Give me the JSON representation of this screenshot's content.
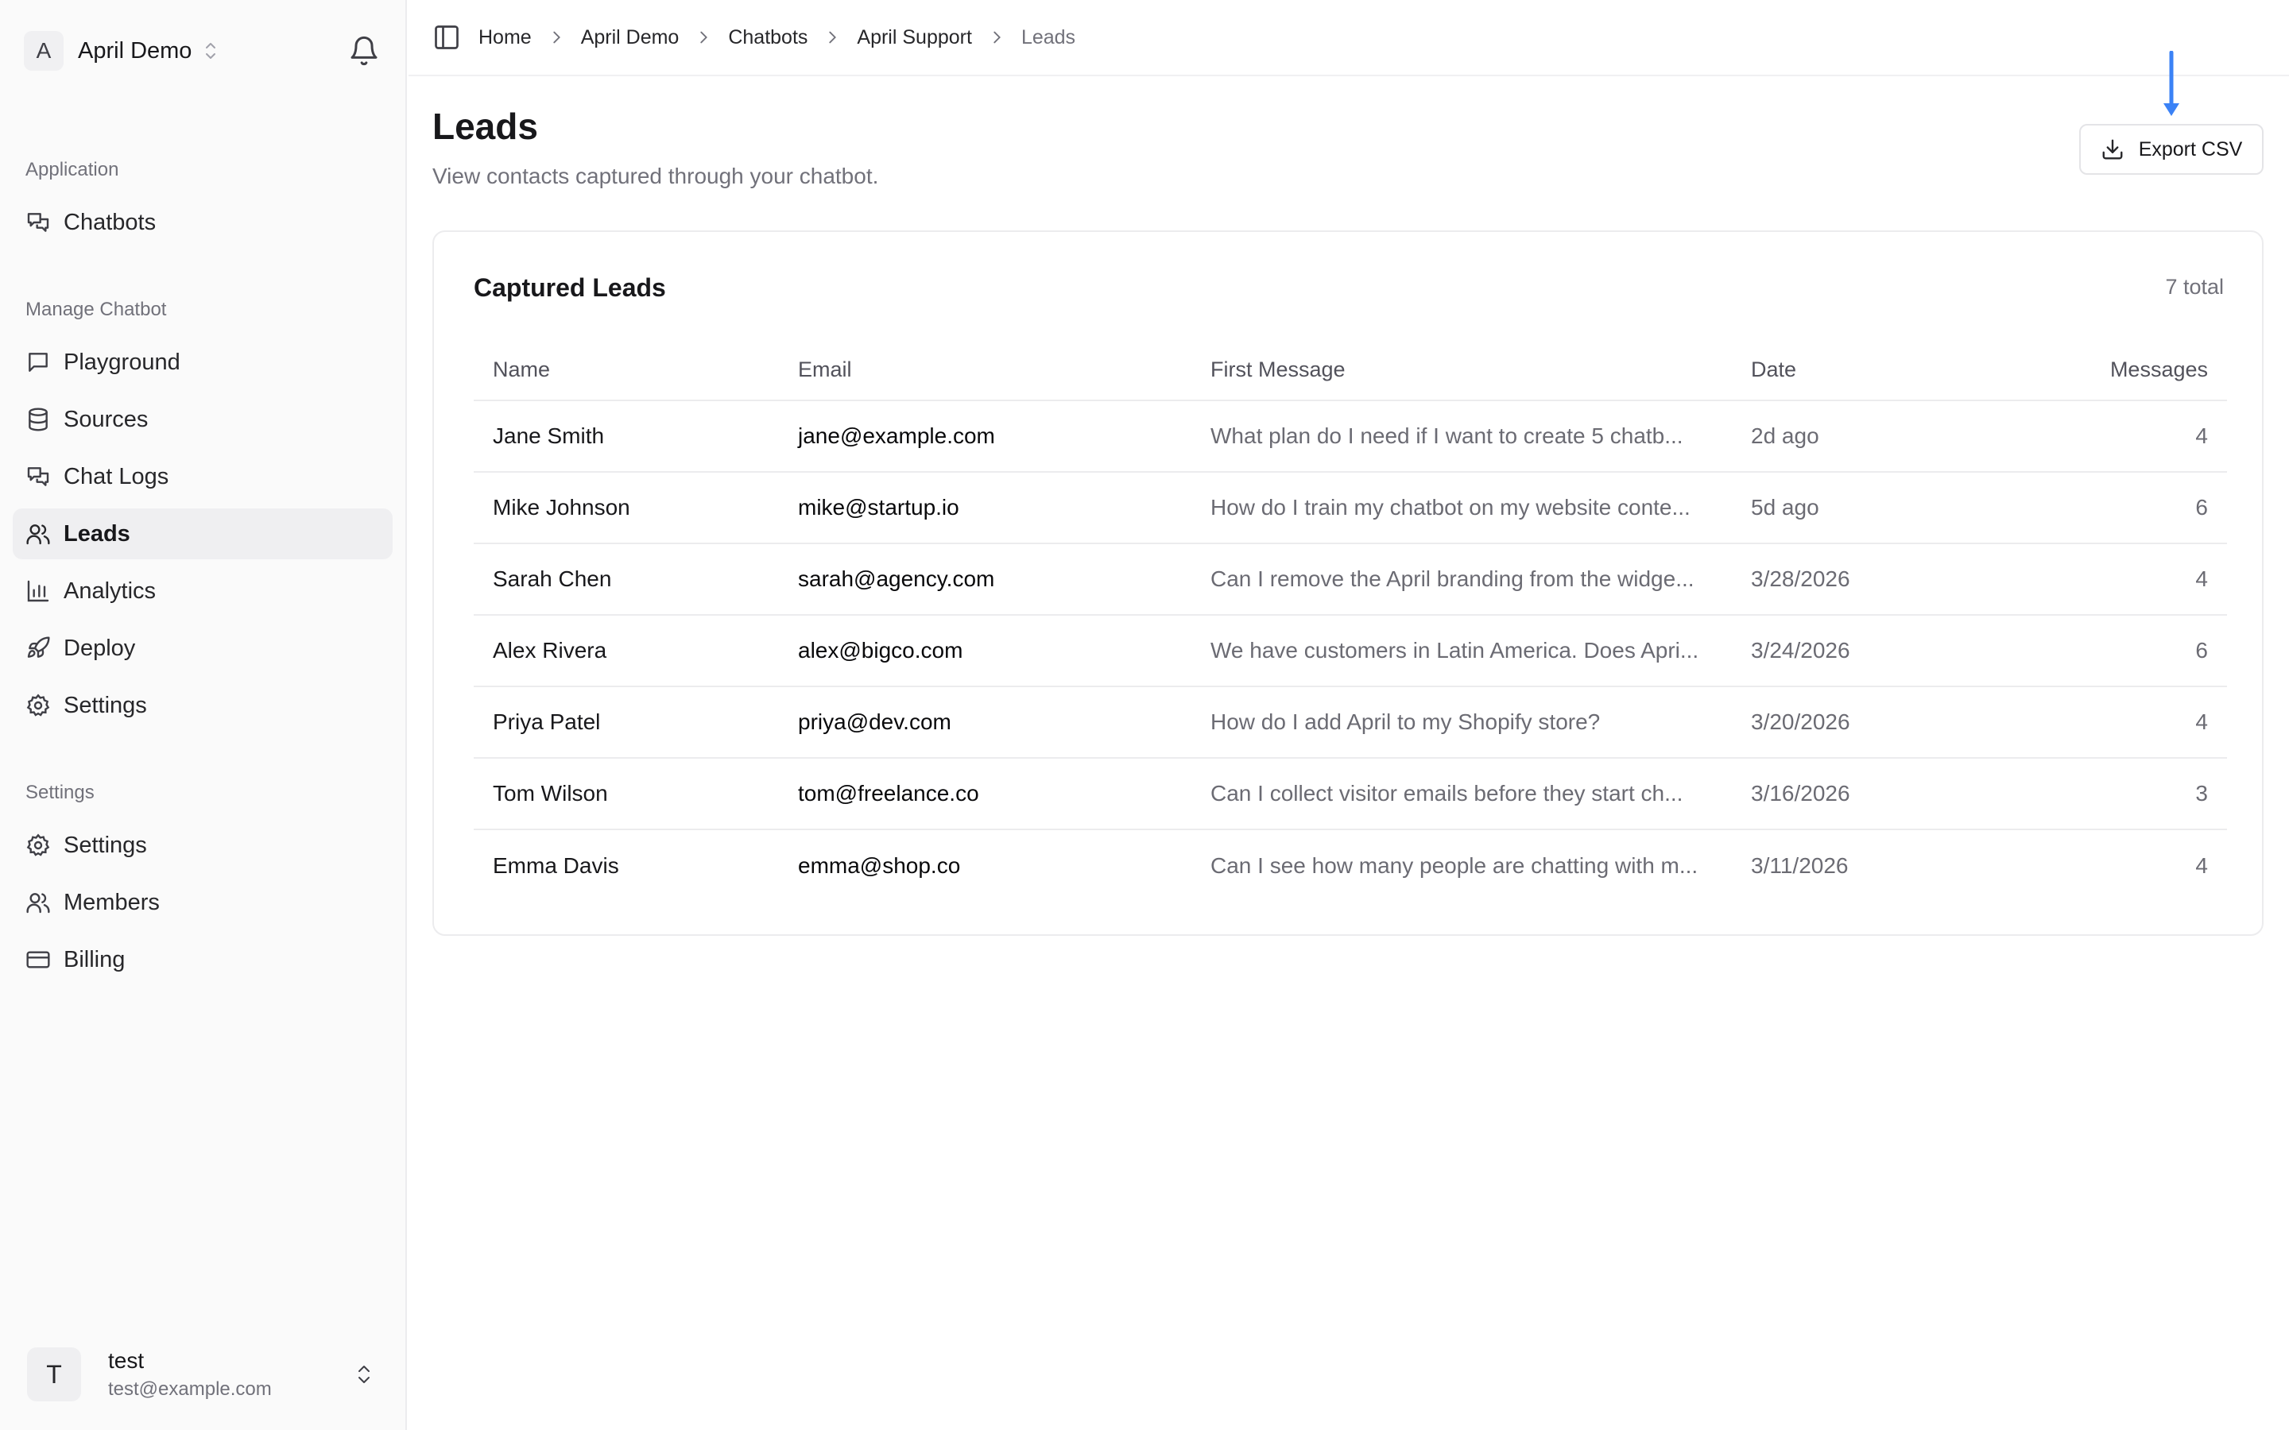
{
  "workspace": {
    "initial": "A",
    "name": "April Demo"
  },
  "sidebar": {
    "groups": {
      "application": "Application",
      "manage": "Manage Chatbot",
      "settings": "Settings"
    },
    "items": {
      "chatbots": "Chatbots",
      "playground": "Playground",
      "sources": "Sources",
      "chat_logs": "Chat Logs",
      "leads": "Leads",
      "analytics": "Analytics",
      "deploy": "Deploy",
      "bot_settings": "Settings",
      "org_settings": "Settings",
      "members": "Members",
      "billing": "Billing"
    },
    "active": "Leads"
  },
  "user": {
    "initial": "T",
    "name": "test",
    "email": "test@example.com"
  },
  "breadcrumb": [
    "Home",
    "April Demo",
    "Chatbots",
    "April Support",
    "Leads"
  ],
  "page": {
    "title": "Leads",
    "subtitle": "View contacts captured through your chatbot.",
    "export_label": "Export CSV"
  },
  "leads_card": {
    "title": "Captured Leads",
    "count": "7 total",
    "columns": [
      "Name",
      "Email",
      "First Message",
      "Date",
      "Messages"
    ],
    "rows": [
      {
        "name": "Jane Smith",
        "email": "jane@example.com",
        "message": "What plan do I need if I want to create 5 chatb...",
        "date": "2d ago",
        "messages": "4"
      },
      {
        "name": "Mike Johnson",
        "email": "mike@startup.io",
        "message": "How do I train my chatbot on my website conte...",
        "date": "5d ago",
        "messages": "6"
      },
      {
        "name": "Sarah Chen",
        "email": "sarah@agency.com",
        "message": "Can I remove the April branding from the widge...",
        "date": "3/28/2026",
        "messages": "4"
      },
      {
        "name": "Alex Rivera",
        "email": "alex@bigco.com",
        "message": "We have customers in Latin America. Does Apri...",
        "date": "3/24/2026",
        "messages": "6"
      },
      {
        "name": "Priya Patel",
        "email": "priya@dev.com",
        "message": "How do I add April to my Shopify store?",
        "date": "3/20/2026",
        "messages": "4"
      },
      {
        "name": "Tom Wilson",
        "email": "tom@freelance.co",
        "message": "Can I collect visitor emails before they start ch...",
        "date": "3/16/2026",
        "messages": "3"
      },
      {
        "name": "Emma Davis",
        "email": "emma@shop.co",
        "message": "Can I see how many people are chatting with m...",
        "date": "3/11/2026",
        "messages": "4"
      }
    ]
  },
  "colors": {
    "accent_arrow": "#3b82f6",
    "sidebar_bg": "#fafafa",
    "active_item_bg": "#efeff1",
    "muted_text": "#71717a"
  }
}
